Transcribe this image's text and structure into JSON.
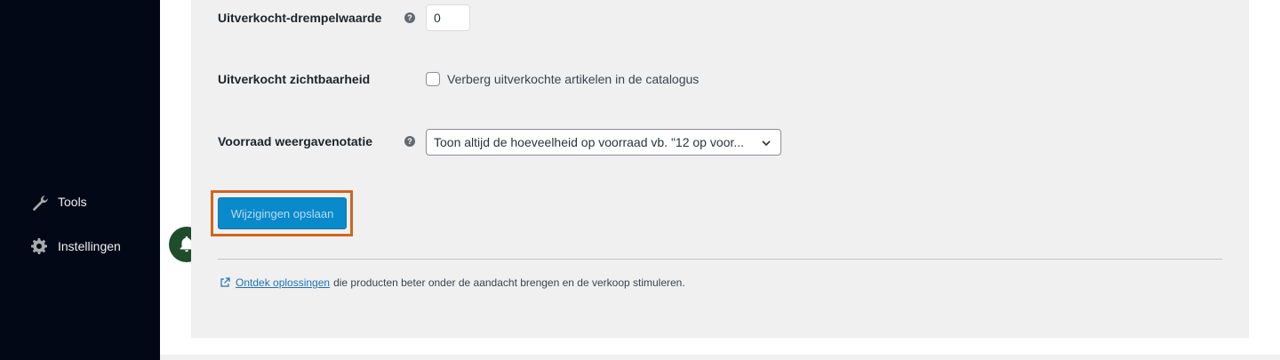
{
  "sidebar": {
    "items": [
      {
        "label": "Tools",
        "icon": "wrench-icon"
      },
      {
        "label": "Instellingen",
        "icon": "gear-icon"
      }
    ]
  },
  "form": {
    "threshold": {
      "label": "Uitverkocht-drempelwaarde",
      "value": "0"
    },
    "visibility": {
      "label": "Uitverkocht zichtbaarheid",
      "checkbox_label": "Verberg uitverkochte artikelen in de catalogus",
      "checked": false
    },
    "display_format": {
      "label": "Voorraad weergavenotatie",
      "selected": "Toon altijd de hoeveelheid op voorraad vb. \"12 op voor..."
    }
  },
  "save_button": {
    "label": "Wijzigingen opslaan"
  },
  "footer": {
    "link_text": "Ontdek oplossingen",
    "text": "die producten beter onder de aandacht brengen en de verkoop stimuleren."
  },
  "colors": {
    "sidebar_bg": "#020816",
    "accent": "#0a89cb",
    "highlight": "#d0661c",
    "bell_bg": "#1f4d2b"
  }
}
